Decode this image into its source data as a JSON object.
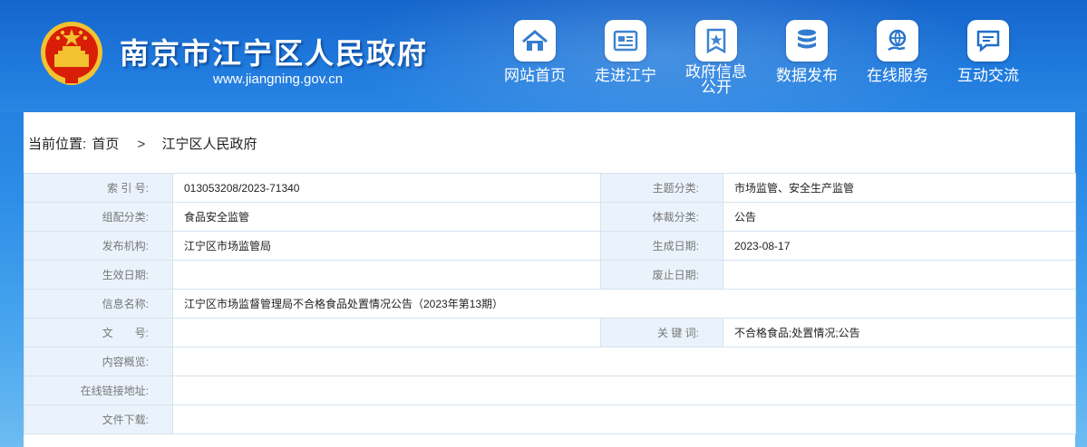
{
  "header": {
    "site_title": "南京市江宁区人民政府",
    "site_url": "www.jiangning.gov.cn",
    "colors": {
      "header_bg": "#1f7add",
      "emblem_red": "#d81e06",
      "emblem_gold": "#f2c230"
    }
  },
  "nav": [
    {
      "label": "网站首页",
      "icon": "home-icon"
    },
    {
      "label": "走进江宁",
      "icon": "newspaper-icon"
    },
    {
      "label": "政府信息",
      "label2": "公开",
      "icon": "document-star-icon"
    },
    {
      "label": "数据发布",
      "icon": "database-icon"
    },
    {
      "label": "在线服务",
      "icon": "globe-hand-icon"
    },
    {
      "label": "互动交流",
      "icon": "chat-icon"
    }
  ],
  "breadcrumb": {
    "prefix": "当前位置:",
    "items": [
      "首页",
      "江宁区人民政府"
    ],
    "separator": ">"
  },
  "info": {
    "rows": [
      {
        "l1": "索 引 号:",
        "v1": "013053208/2023-71340",
        "l2": "主题分类:",
        "v2": "市场监管、安全生产监管"
      },
      {
        "l1": "组配分类:",
        "v1": "食品安全监管",
        "l2": "体裁分类:",
        "v2": "公告"
      },
      {
        "l1": "发布机构:",
        "v1": "江宁区市场监管局",
        "l2": "生成日期:",
        "v2": "2023-08-17"
      },
      {
        "l1": "生效日期:",
        "v1": "",
        "l2": "废止日期:",
        "v2": ""
      }
    ],
    "title_label": "信息名称:",
    "title_value": "江宁区市场监督管理局不合格食品处置情况公告（2023年第13期）",
    "doc_no_label": "文　　号:",
    "doc_no_value": "",
    "keywords_label": "关 键 词:",
    "keywords_value": "不合格食品;处置情况;公告",
    "summary_label": "内容概览:",
    "summary_value": "",
    "link_label": "在线链接地址:",
    "link_value": "",
    "download_label": "文件下载:",
    "download_value": ""
  }
}
